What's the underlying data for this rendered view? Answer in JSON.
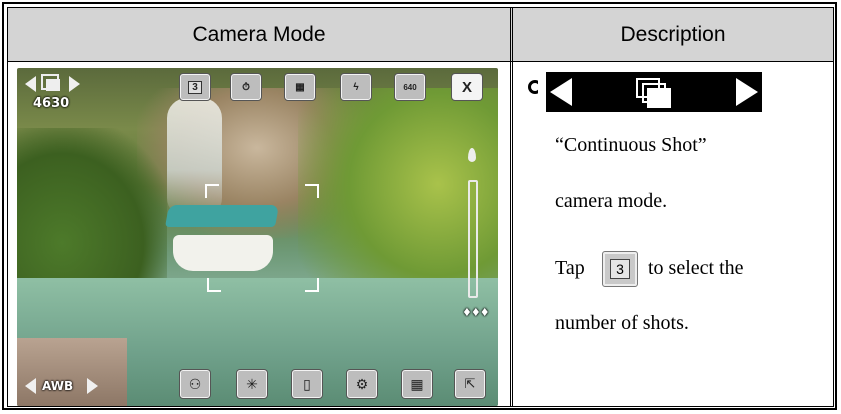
{
  "header": {
    "left": "Camera Mode",
    "right": "Description"
  },
  "camera": {
    "shot_count": "4630",
    "awb_label": "AWB",
    "top_icons": [
      "continuous-shot-3-icon",
      "self-timer-icon",
      "date-stamp-icon",
      "flash-off-icon",
      "resolution-640-icon",
      "close-icon"
    ],
    "resolution_label": "640",
    "continuous_count_label": "3",
    "close_label": "X",
    "bottom_icons": [
      "scene-mode-icon",
      "effect-icon",
      "storage-icon",
      "settings-icon",
      "grid-icon",
      "fullscreen-icon"
    ]
  },
  "description": {
    "line1": "“Continuous Shot”",
    "line2": "camera mode.",
    "line3_before": "Tap",
    "line3_after": "to select the",
    "line4": "number of shots.",
    "tap_icon_label": "3"
  },
  "colors": {
    "header_bg": "#d4d4d4",
    "icon_bg": "#bdbdbd",
    "canopy": "#3fa3a0"
  }
}
